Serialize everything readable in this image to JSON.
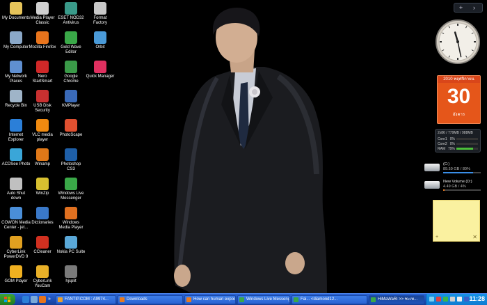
{
  "desktop": {
    "icons": [
      {
        "id": "my-documents",
        "label": "My Documents",
        "col": 0,
        "row": 0,
        "color": "#e6c45a",
        "icon": "folder-icon"
      },
      {
        "id": "my-computer",
        "label": "My Computer",
        "col": 0,
        "row": 1,
        "color": "#8aa8c8",
        "icon": "computer-icon"
      },
      {
        "id": "my-network-places",
        "label": "My Network\nPlaces",
        "col": 0,
        "row": 2,
        "color": "#5f8fd0",
        "icon": "network-icon"
      },
      {
        "id": "recycle-bin",
        "label": "Recycle Bin",
        "col": 0,
        "row": 3,
        "color": "#9fb4c8",
        "icon": "recycle-bin-icon"
      },
      {
        "id": "internet-explorer",
        "label": "Internet\nExplorer",
        "col": 0,
        "row": 4,
        "color": "#2b7fd8",
        "icon": "ie-icon"
      },
      {
        "id": "acdsee-photo",
        "label": "ACDSee Photo",
        "col": 0,
        "row": 5,
        "color": "#3aa6d8",
        "icon": "acdsee-icon"
      },
      {
        "id": "auto-shut-down",
        "label": "Auto Shut\ndown",
        "col": 0,
        "row": 6,
        "color": "#c0c0c0",
        "icon": "timer-icon"
      },
      {
        "id": "cowon-media-center",
        "label": "COWON Media\nCenter - jet...",
        "col": 0,
        "row": 7,
        "color": "#4a8ed8",
        "icon": "cowon-icon"
      },
      {
        "id": "cyberlink-powerdvd",
        "label": "CyberLink\nPowerDVD 9",
        "col": 0,
        "row": 8,
        "color": "#e0a020",
        "icon": "dvd-icon"
      },
      {
        "id": "gom-player",
        "label": "GOM Player",
        "col": 0,
        "row": 9,
        "color": "#f0b020",
        "icon": "gom-icon"
      },
      {
        "id": "media-player-classic",
        "label": "Media Player\nClassic",
        "col": 1,
        "row": 0,
        "color": "#d0d0d0",
        "icon": "media-player-icon"
      },
      {
        "id": "mozilla-firefox",
        "label": "Mozilla Firefox",
        "col": 1,
        "row": 1,
        "color": "#e8741c",
        "icon": "firefox-icon"
      },
      {
        "id": "nero-startsmart",
        "label": "Nero\nStartSmart",
        "col": 1,
        "row": 2,
        "color": "#d02828",
        "icon": "nero-icon"
      },
      {
        "id": "usb-disk-security",
        "label": "USB Disk\nSecurity",
        "col": 1,
        "row": 3,
        "color": "#c83030",
        "icon": "usb-shield-icon"
      },
      {
        "id": "vlc-media-player",
        "label": "VLC media\nplayer",
        "col": 1,
        "row": 4,
        "color": "#f08a10",
        "icon": "vlc-cone-icon"
      },
      {
        "id": "winamp",
        "label": "Winamp",
        "col": 1,
        "row": 5,
        "color": "#e07818",
        "icon": "winamp-icon"
      },
      {
        "id": "winzip",
        "label": "WinZip",
        "col": 1,
        "row": 6,
        "color": "#d8c030",
        "icon": "winzip-icon"
      },
      {
        "id": "dictionaries",
        "label": "Dictionaries",
        "col": 1,
        "row": 7,
        "color": "#3a78c8",
        "icon": "dictionary-icon"
      },
      {
        "id": "ccleaner",
        "label": "CCleaner",
        "col": 1,
        "row": 8,
        "color": "#d03020",
        "icon": "ccleaner-icon"
      },
      {
        "id": "cyberlink-youcam",
        "label": "CyberLink\nYouCam",
        "col": 1,
        "row": 9,
        "color": "#e8b028",
        "icon": "webcam-icon"
      },
      {
        "id": "eset-nod32",
        "label": "ESET NOD32\nAntivirus",
        "col": 2,
        "row": 0,
        "color": "#3a9a8a",
        "icon": "eset-icon"
      },
      {
        "id": "gold-wave-editor",
        "label": "Gold Wave\nEditor",
        "col": 2,
        "row": 1,
        "color": "#3aa848",
        "icon": "goldwave-icon"
      },
      {
        "id": "google-chrome",
        "label": "Google\nChrome",
        "col": 2,
        "row": 2,
        "color": "#3a9a48",
        "icon": "chrome-icon"
      },
      {
        "id": "kmplayer",
        "label": "KMPlayer",
        "col": 2,
        "row": 3,
        "color": "#3a6ab8",
        "icon": "kmplayer-icon"
      },
      {
        "id": "photoscape",
        "label": "PhotoScape",
        "col": 2,
        "row": 4,
        "color": "#e05030",
        "icon": "photoscape-icon"
      },
      {
        "id": "photoshop-cs3",
        "label": "Photoshop\nCS3",
        "col": 2,
        "row": 5,
        "color": "#1e5fa8",
        "icon": "photoshop-icon"
      },
      {
        "id": "windows-live-messenger",
        "label": "Windows Live\nMessenger",
        "col": 2,
        "row": 6,
        "color": "#3aa848",
        "icon": "messenger-icon"
      },
      {
        "id": "windows-media-player",
        "label": "Windows\nMedia Player",
        "col": 2,
        "row": 7,
        "color": "#e07020",
        "icon": "wmp-icon"
      },
      {
        "id": "nokia-pc-suite",
        "label": "Nokia PC Suite",
        "col": 2,
        "row": 8,
        "color": "#5aa8d8",
        "icon": "nokia-icon"
      },
      {
        "id": "hjsplit",
        "label": "hjsplit",
        "col": 2,
        "row": 9,
        "color": "#7a7a7a",
        "icon": "hjsplit-icon"
      },
      {
        "id": "format-factory",
        "label": "Format\nFactory",
        "col": 3,
        "row": 0,
        "color": "#c8c8c8",
        "icon": "format-factory-icon"
      },
      {
        "id": "orbit",
        "label": "Orbit",
        "col": 3,
        "row": 1,
        "color": "#4a9ad8",
        "icon": "orbit-icon"
      },
      {
        "id": "quick-manager",
        "label": "Quick Manager",
        "col": 3,
        "row": 2,
        "color": "#e03060",
        "icon": "quick-manager-icon"
      }
    ]
  },
  "sidebar": {
    "top_buttons": [
      "+",
      "›"
    ],
    "clock": {
      "hour": 11,
      "minute": 28
    },
    "calendar": {
      "header": "2010 พฤศจิกายน",
      "day": "30",
      "weekday": "อังคาร"
    },
    "meter": {
      "header": "2x86 / 779MB / 988MB",
      "rows": [
        {
          "label": "Core1",
          "value": "0%",
          "fill": 0
        },
        {
          "label": "Core2",
          "value": "0%",
          "fill": 0
        },
        {
          "label": "RAM",
          "value": "79%",
          "fill": 0.79
        }
      ]
    },
    "drives": [
      {
        "title": "(C:)",
        "info": "89.59 GB / 80%",
        "fill": 0.8,
        "color": "#3a8ee8"
      },
      {
        "title": "New Volume (D:)",
        "info": "4.49 GB / 4%",
        "fill": 0.04,
        "color": "#e87a20"
      }
    ],
    "note": {
      "plus": "+",
      "close": "✕"
    }
  },
  "taskbar": {
    "tasks": [
      {
        "label": "FANTIP.COM : A9974...",
        "color": "#e8a030",
        "active": false
      },
      {
        "label": "Downloads",
        "color": "#e87a20",
        "active": false
      },
      {
        "label": "How can human expos...",
        "color": "#e87a20",
        "active": false
      },
      {
        "label": "Windows Live Messenger",
        "color": "#3aa848",
        "active": false
      },
      {
        "label": "Fai... <diamond12...",
        "color": "#3aa848",
        "active": false
      },
      {
        "label": "HiMaWaRi >> ซะเท...",
        "color": "#3aa848",
        "active": true
      }
    ],
    "clock": "11:28"
  },
  "colors": {
    "taskbar": "#245edb",
    "tray": "#1290e8",
    "calendar": "#e5561a",
    "note": "#faf1a0"
  }
}
